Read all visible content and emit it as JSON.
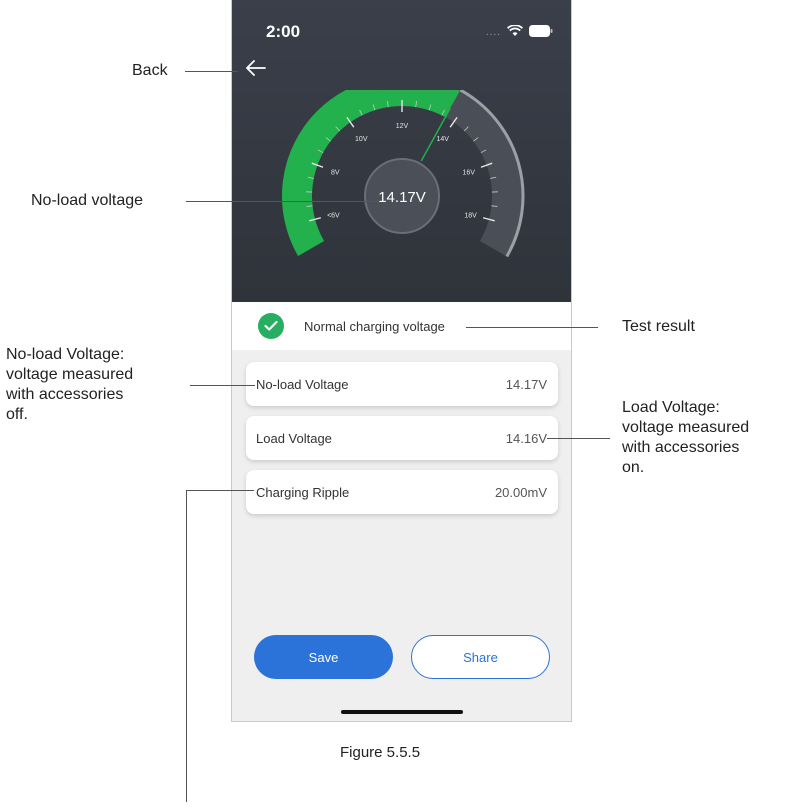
{
  "status": {
    "time": "2:00"
  },
  "gauge": {
    "reading": "14.17V",
    "ticks": [
      "<6V",
      "8V",
      "10V",
      "12V",
      "14V",
      "16V",
      "18V"
    ],
    "value_fraction": 0.62,
    "colors": {
      "filled": "#22b14c",
      "unfilled": "#4a4f57",
      "rim": "#9aa0a6"
    }
  },
  "result": {
    "text": "Normal charging voltage",
    "color": "#27ae60"
  },
  "rows": [
    {
      "label": "No-load Voltage",
      "value": "14.17V"
    },
    {
      "label": "Load Voltage",
      "value": "14.16V"
    },
    {
      "label": "Charging Ripple",
      "value": "20.00mV"
    }
  ],
  "buttons": {
    "save": "Save",
    "share": "Share",
    "accent": "#2b73d8"
  },
  "annotations": {
    "back": "Back",
    "noload": "No-load voltage",
    "test_result": "Test result",
    "noload_desc": [
      "No-load Voltage:",
      "voltage measured",
      "with accessories",
      "off."
    ],
    "load_desc": [
      "Load Voltage:",
      "voltage measured",
      "with accessories",
      "on."
    ]
  },
  "caption": "Figure 5.5.5",
  "icons": [
    "back-arrow-icon",
    "wifi-icon",
    "battery-icon",
    "signal-dots-icon",
    "check-icon"
  ]
}
